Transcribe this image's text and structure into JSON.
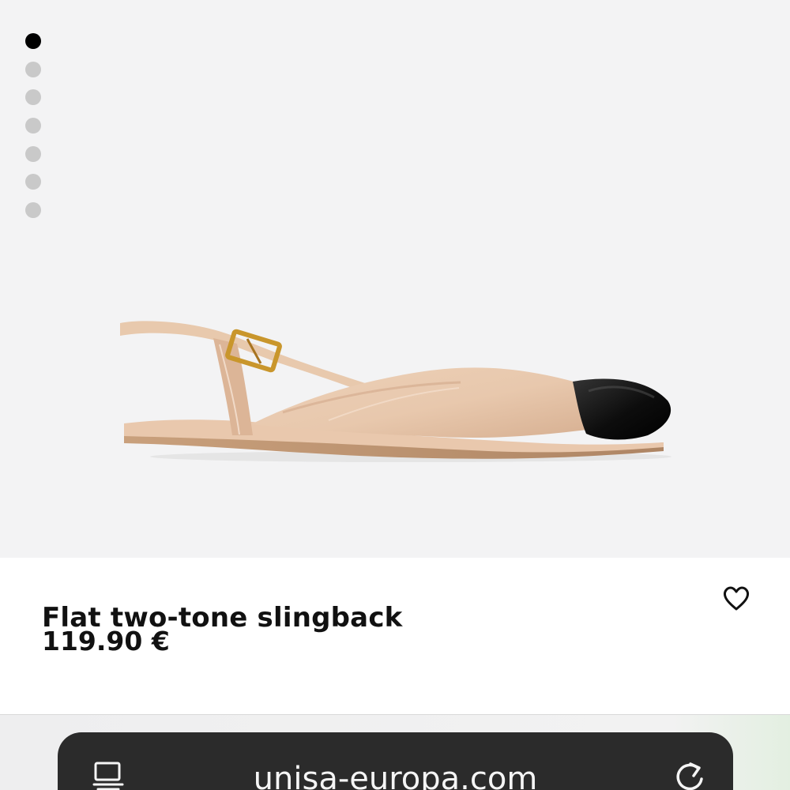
{
  "product": {
    "name": "Flat two-tone slingback",
    "price": "119.90 €",
    "image_icon": "slingback-shoe-image",
    "wishlist_icon": "heart-icon"
  },
  "gallery": {
    "image_count": 7,
    "active_index": 0
  },
  "browser": {
    "url": "unisa-europa.com",
    "left_icon": "tabs-icon",
    "right_icon": "reload-icon"
  },
  "colors": {
    "gallery_background": "#f3f3f4",
    "active_dot": "#000000",
    "inactive_dot": "#c9c9c9",
    "text": "#111111",
    "address_bar": "#2b2b2b"
  }
}
